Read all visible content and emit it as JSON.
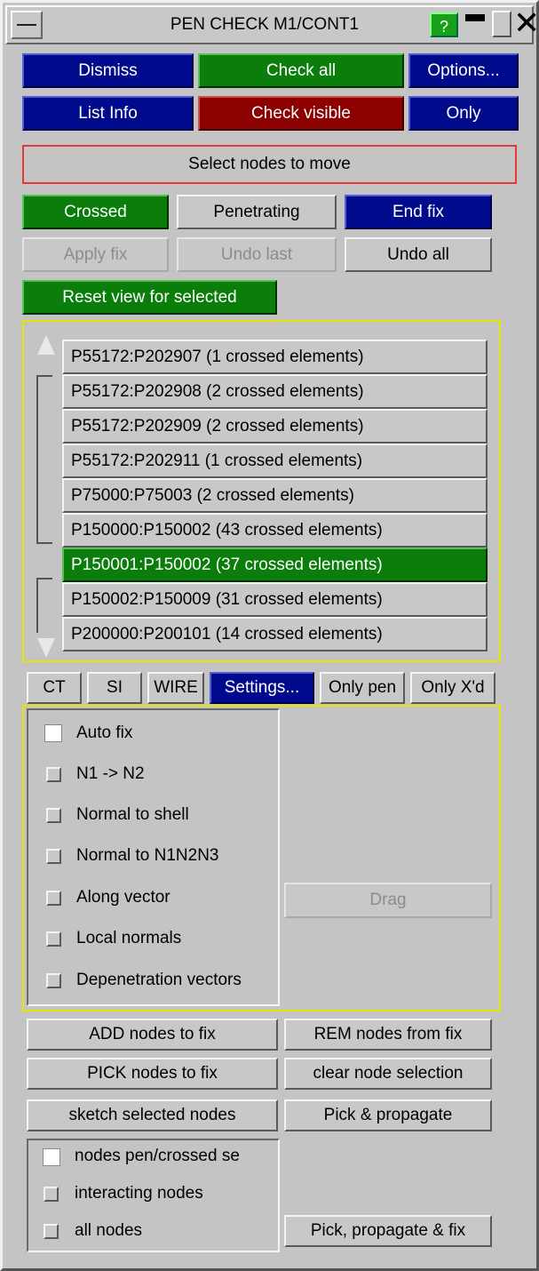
{
  "window": {
    "title": "PEN CHECK M1/CONT1",
    "help_label": "?"
  },
  "toolbar": {
    "dismiss": "Dismiss",
    "check_all": "Check all",
    "options": "Options...",
    "list_info": "List Info",
    "check_visible": "Check visible",
    "only": "Only"
  },
  "status": "Select nodes to move",
  "fix": {
    "crossed": "Crossed",
    "penetrating": "Penetrating",
    "end_fix": "End fix",
    "apply_fix": "Apply fix",
    "undo_last": "Undo last",
    "undo_all": "Undo all",
    "reset_view": "Reset view for selected"
  },
  "list": {
    "items": [
      "P55172:P202907 (1 crossed elements)",
      "P55172:P202908 (2 crossed elements)",
      "P55172:P202909 (2 crossed elements)",
      "P55172:P202911 (1 crossed elements)",
      "P75000:P75003 (2 crossed elements)",
      "P150000:P150002 (43 crossed elements)",
      "P150001:P150002 (37 crossed elements)",
      "P150002:P150009 (31 crossed elements)",
      "P200000:P200101 (14 crossed elements)"
    ],
    "selected_index": 6
  },
  "filters": {
    "ct": "CT",
    "si": "SI",
    "wire": "WIRE",
    "settings": "Settings...",
    "only_pen": "Only pen",
    "only_xd": "Only X'd"
  },
  "options": {
    "items": [
      {
        "label": "Auto fix",
        "checked": true
      },
      {
        "label": "N1 -> N2",
        "checked": false
      },
      {
        "label": "Normal to shell",
        "checked": false
      },
      {
        "label": "Normal to N1N2N3",
        "checked": false
      },
      {
        "label": "Along vector",
        "checked": false
      },
      {
        "label": "Local normals",
        "checked": false
      },
      {
        "label": "Depenetration vectors",
        "checked": false
      }
    ],
    "drag": "Drag"
  },
  "nodes": {
    "add": "ADD nodes to fix",
    "rem": "REM nodes from fix",
    "pick": "PICK nodes to fix",
    "clear": "clear node selection",
    "sketch": "sketch selected nodes",
    "propagate": "Pick & propagate",
    "propagate_fix": "Pick, propagate & fix"
  },
  "display": {
    "items": [
      {
        "label": "nodes pen/crossed se",
        "checked": true
      },
      {
        "label": "interacting nodes",
        "checked": false
      },
      {
        "label": "all nodes",
        "checked": false
      }
    ]
  },
  "colors": {
    "blue": "#000a8c",
    "green": "#0a7d0a",
    "red": "#8c0000",
    "panel": "#c4c4c4",
    "highlight_border": "#e5e500",
    "status_border": "#e23a3a"
  }
}
